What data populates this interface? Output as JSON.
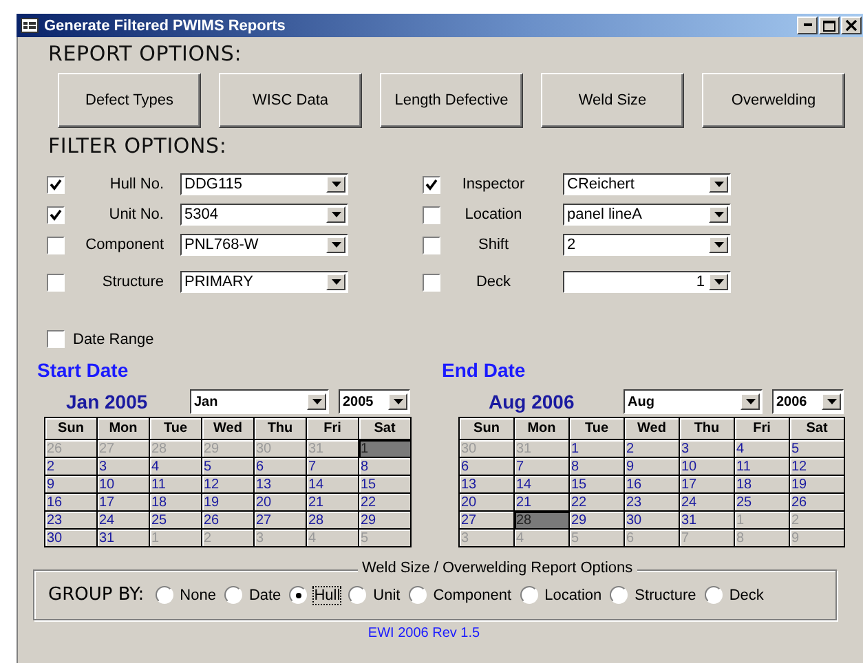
{
  "window": {
    "title": "Generate Filtered PWIMS Reports"
  },
  "report_options": {
    "heading": "REPORT OPTIONS:",
    "buttons": [
      "Defect Types",
      "WISC Data",
      "Length Defective",
      "Weld Size",
      "Overwelding"
    ]
  },
  "filter_options": {
    "heading": "FILTER OPTIONS:",
    "left": [
      {
        "label": "Hull No.",
        "checked": true,
        "value": "DDG115"
      },
      {
        "label": "Unit No.",
        "checked": true,
        "value": "5304"
      },
      {
        "label": "Component",
        "checked": false,
        "value": "PNL768-W"
      },
      {
        "label": "Structure",
        "checked": false,
        "value": "PRIMARY"
      }
    ],
    "right": [
      {
        "label": "Inspector",
        "checked": true,
        "value": "CReichert"
      },
      {
        "label": "Location",
        "checked": false,
        "value": "panel lineA"
      },
      {
        "label": "Shift",
        "checked": false,
        "value": "2"
      },
      {
        "label": "Deck",
        "checked": false,
        "value": "1",
        "kind": "number"
      }
    ]
  },
  "date_range": {
    "label": "Date Range",
    "checked": false
  },
  "calendars": [
    {
      "title": "Start Date",
      "month_label": "Jan 2005",
      "month": "Jan",
      "year": "2005",
      "weekdays": [
        "Sun",
        "Mon",
        "Tue",
        "Wed",
        "Thu",
        "Fri",
        "Sat"
      ],
      "weeks": [
        [
          {
            "day": "26",
            "kind": "other",
            "selected": false
          },
          {
            "day": "27",
            "kind": "other",
            "selected": false
          },
          {
            "day": "28",
            "kind": "other",
            "selected": false
          },
          {
            "day": "29",
            "kind": "other",
            "selected": false
          },
          {
            "day": "30",
            "kind": "other",
            "selected": false
          },
          {
            "day": "31",
            "kind": "other",
            "selected": false
          },
          {
            "day": "1",
            "kind": "current",
            "selected": true
          }
        ],
        [
          {
            "day": "2",
            "kind": "current",
            "selected": false
          },
          {
            "day": "3",
            "kind": "current",
            "selected": false
          },
          {
            "day": "4",
            "kind": "current",
            "selected": false
          },
          {
            "day": "5",
            "kind": "current",
            "selected": false
          },
          {
            "day": "6",
            "kind": "current",
            "selected": false
          },
          {
            "day": "7",
            "kind": "current",
            "selected": false
          },
          {
            "day": "8",
            "kind": "current",
            "selected": false
          }
        ],
        [
          {
            "day": "9",
            "kind": "current",
            "selected": false
          },
          {
            "day": "10",
            "kind": "current",
            "selected": false
          },
          {
            "day": "11",
            "kind": "current",
            "selected": false
          },
          {
            "day": "12",
            "kind": "current",
            "selected": false
          },
          {
            "day": "13",
            "kind": "current",
            "selected": false
          },
          {
            "day": "14",
            "kind": "current",
            "selected": false
          },
          {
            "day": "15",
            "kind": "current",
            "selected": false
          }
        ],
        [
          {
            "day": "16",
            "kind": "current",
            "selected": false
          },
          {
            "day": "17",
            "kind": "current",
            "selected": false
          },
          {
            "day": "18",
            "kind": "current",
            "selected": false
          },
          {
            "day": "19",
            "kind": "current",
            "selected": false
          },
          {
            "day": "20",
            "kind": "current",
            "selected": false
          },
          {
            "day": "21",
            "kind": "current",
            "selected": false
          },
          {
            "day": "22",
            "kind": "current",
            "selected": false
          }
        ],
        [
          {
            "day": "23",
            "kind": "current",
            "selected": false
          },
          {
            "day": "24",
            "kind": "current",
            "selected": false
          },
          {
            "day": "25",
            "kind": "current",
            "selected": false
          },
          {
            "day": "26",
            "kind": "current",
            "selected": false
          },
          {
            "day": "27",
            "kind": "current",
            "selected": false
          },
          {
            "day": "28",
            "kind": "current",
            "selected": false
          },
          {
            "day": "29",
            "kind": "current",
            "selected": false
          }
        ],
        [
          {
            "day": "30",
            "kind": "current",
            "selected": false
          },
          {
            "day": "31",
            "kind": "current",
            "selected": false
          },
          {
            "day": "1",
            "kind": "other",
            "selected": false
          },
          {
            "day": "2",
            "kind": "other",
            "selected": false
          },
          {
            "day": "3",
            "kind": "other",
            "selected": false
          },
          {
            "day": "4",
            "kind": "other",
            "selected": false
          },
          {
            "day": "5",
            "kind": "other",
            "selected": false
          }
        ]
      ]
    },
    {
      "title": "End Date",
      "month_label": "Aug 2006",
      "month": "Aug",
      "year": "2006",
      "weekdays": [
        "Sun",
        "Mon",
        "Tue",
        "Wed",
        "Thu",
        "Fri",
        "Sat"
      ],
      "weeks": [
        [
          {
            "day": "30",
            "kind": "other",
            "selected": false
          },
          {
            "day": "31",
            "kind": "other",
            "selected": false
          },
          {
            "day": "1",
            "kind": "current",
            "selected": false
          },
          {
            "day": "2",
            "kind": "current",
            "selected": false
          },
          {
            "day": "3",
            "kind": "current",
            "selected": false
          },
          {
            "day": "4",
            "kind": "current",
            "selected": false
          },
          {
            "day": "5",
            "kind": "current",
            "selected": false
          }
        ],
        [
          {
            "day": "6",
            "kind": "current",
            "selected": false
          },
          {
            "day": "7",
            "kind": "current",
            "selected": false
          },
          {
            "day": "8",
            "kind": "current",
            "selected": false
          },
          {
            "day": "9",
            "kind": "current",
            "selected": false
          },
          {
            "day": "10",
            "kind": "current",
            "selected": false
          },
          {
            "day": "11",
            "kind": "current",
            "selected": false
          },
          {
            "day": "12",
            "kind": "current",
            "selected": false
          }
        ],
        [
          {
            "day": "13",
            "kind": "current",
            "selected": false
          },
          {
            "day": "14",
            "kind": "current",
            "selected": false
          },
          {
            "day": "15",
            "kind": "current",
            "selected": false
          },
          {
            "day": "16",
            "kind": "current",
            "selected": false
          },
          {
            "day": "17",
            "kind": "current",
            "selected": false
          },
          {
            "day": "18",
            "kind": "current",
            "selected": false
          },
          {
            "day": "19",
            "kind": "current",
            "selected": false
          }
        ],
        [
          {
            "day": "20",
            "kind": "current",
            "selected": false
          },
          {
            "day": "21",
            "kind": "current",
            "selected": false
          },
          {
            "day": "22",
            "kind": "current",
            "selected": false
          },
          {
            "day": "23",
            "kind": "current",
            "selected": false
          },
          {
            "day": "24",
            "kind": "current",
            "selected": false
          },
          {
            "day": "25",
            "kind": "current",
            "selected": false
          },
          {
            "day": "26",
            "kind": "current",
            "selected": false
          }
        ],
        [
          {
            "day": "27",
            "kind": "current",
            "selected": false
          },
          {
            "day": "28",
            "kind": "current",
            "selected": true
          },
          {
            "day": "29",
            "kind": "current",
            "selected": false
          },
          {
            "day": "30",
            "kind": "current",
            "selected": false
          },
          {
            "day": "31",
            "kind": "current",
            "selected": false
          },
          {
            "day": "1",
            "kind": "other",
            "selected": false
          },
          {
            "day": "2",
            "kind": "other",
            "selected": false
          }
        ],
        [
          {
            "day": "3",
            "kind": "other",
            "selected": false
          },
          {
            "day": "4",
            "kind": "other",
            "selected": false
          },
          {
            "day": "5",
            "kind": "other",
            "selected": false
          },
          {
            "day": "6",
            "kind": "other",
            "selected": false
          },
          {
            "day": "7",
            "kind": "other",
            "selected": false
          },
          {
            "day": "8",
            "kind": "other",
            "selected": false
          },
          {
            "day": "9",
            "kind": "other",
            "selected": false
          }
        ]
      ]
    }
  ],
  "group_options": {
    "legend": "Weld Size / Overwelding Report Options",
    "label": "GROUP BY:",
    "options": [
      {
        "label": "None",
        "selected": false
      },
      {
        "label": "Date",
        "selected": false
      },
      {
        "label": "Hull",
        "selected": true
      },
      {
        "label": "Unit",
        "selected": false
      },
      {
        "label": "Component",
        "selected": false
      },
      {
        "label": "Location",
        "selected": false
      },
      {
        "label": "Structure",
        "selected": false
      },
      {
        "label": "Deck",
        "selected": false
      }
    ]
  },
  "footer": "EWI 2006 Rev 1.5"
}
